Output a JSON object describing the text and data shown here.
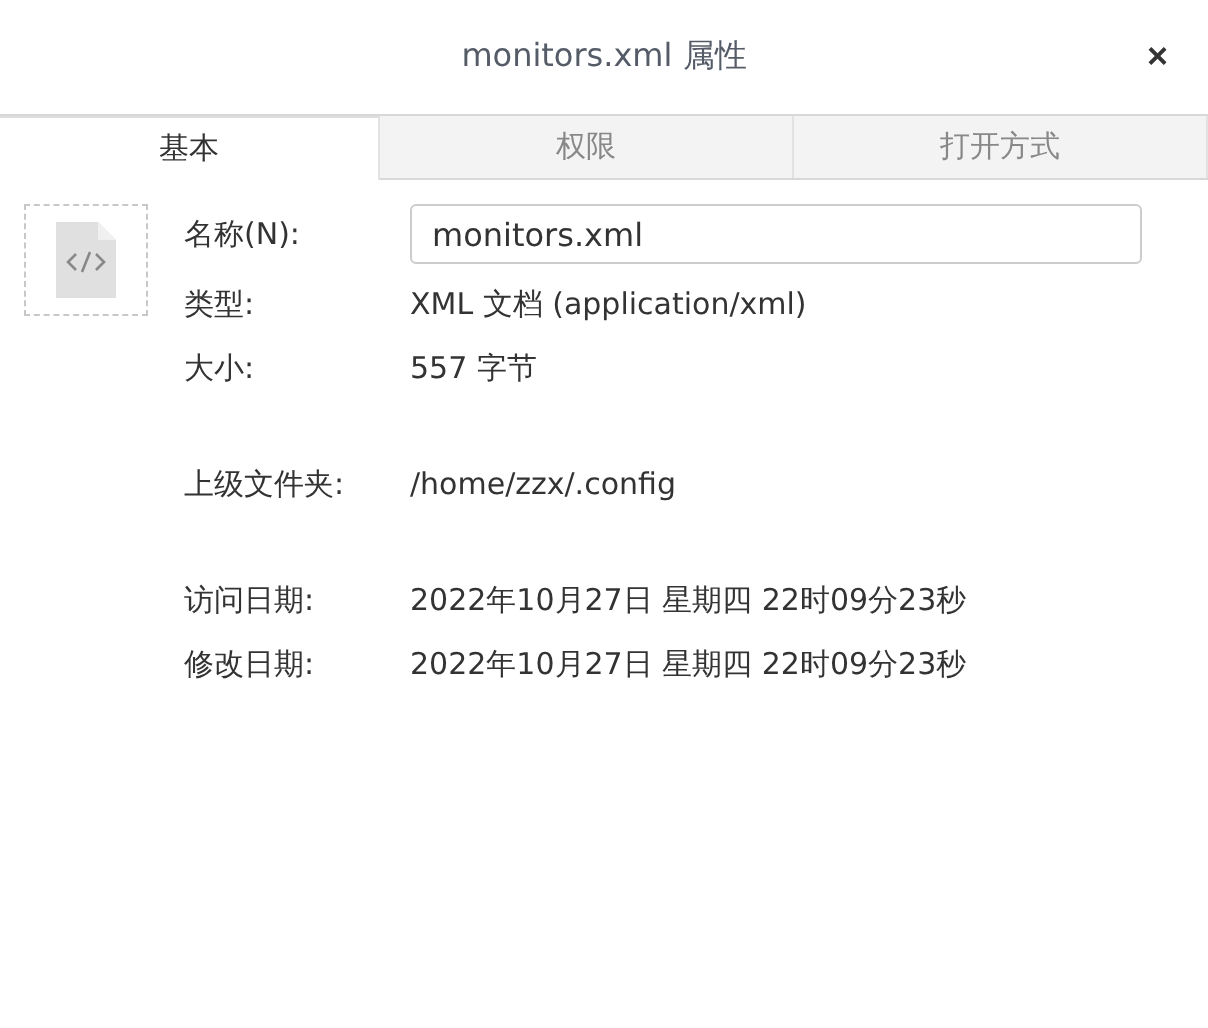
{
  "window": {
    "title": "monitors.xml 属性",
    "close": "×"
  },
  "tabs": [
    {
      "label": "基本",
      "selected": true
    },
    {
      "label": "权限",
      "selected": false
    },
    {
      "label": "打开方式",
      "selected": false
    }
  ],
  "groups": [
    {
      "rows": [
        {
          "label": "名称(N):",
          "kind": "input",
          "value": "monitors.xml"
        },
        {
          "label": "类型:",
          "kind": "text",
          "value": "XML 文档 (application/xml)"
        },
        {
          "label": "大小:",
          "kind": "text",
          "value": "557 字节"
        }
      ]
    },
    {
      "rows": [
        {
          "label": "上级文件夹:",
          "kind": "text",
          "value": "/home/zzx/.config"
        }
      ]
    },
    {
      "rows": [
        {
          "label": "访问日期:",
          "kind": "text",
          "value": "2022年10月27日 星期四 22时09分23秒"
        },
        {
          "label": "修改日期:",
          "kind": "text",
          "value": "2022年10月27日 星期四 22时09分23秒"
        }
      ]
    }
  ]
}
